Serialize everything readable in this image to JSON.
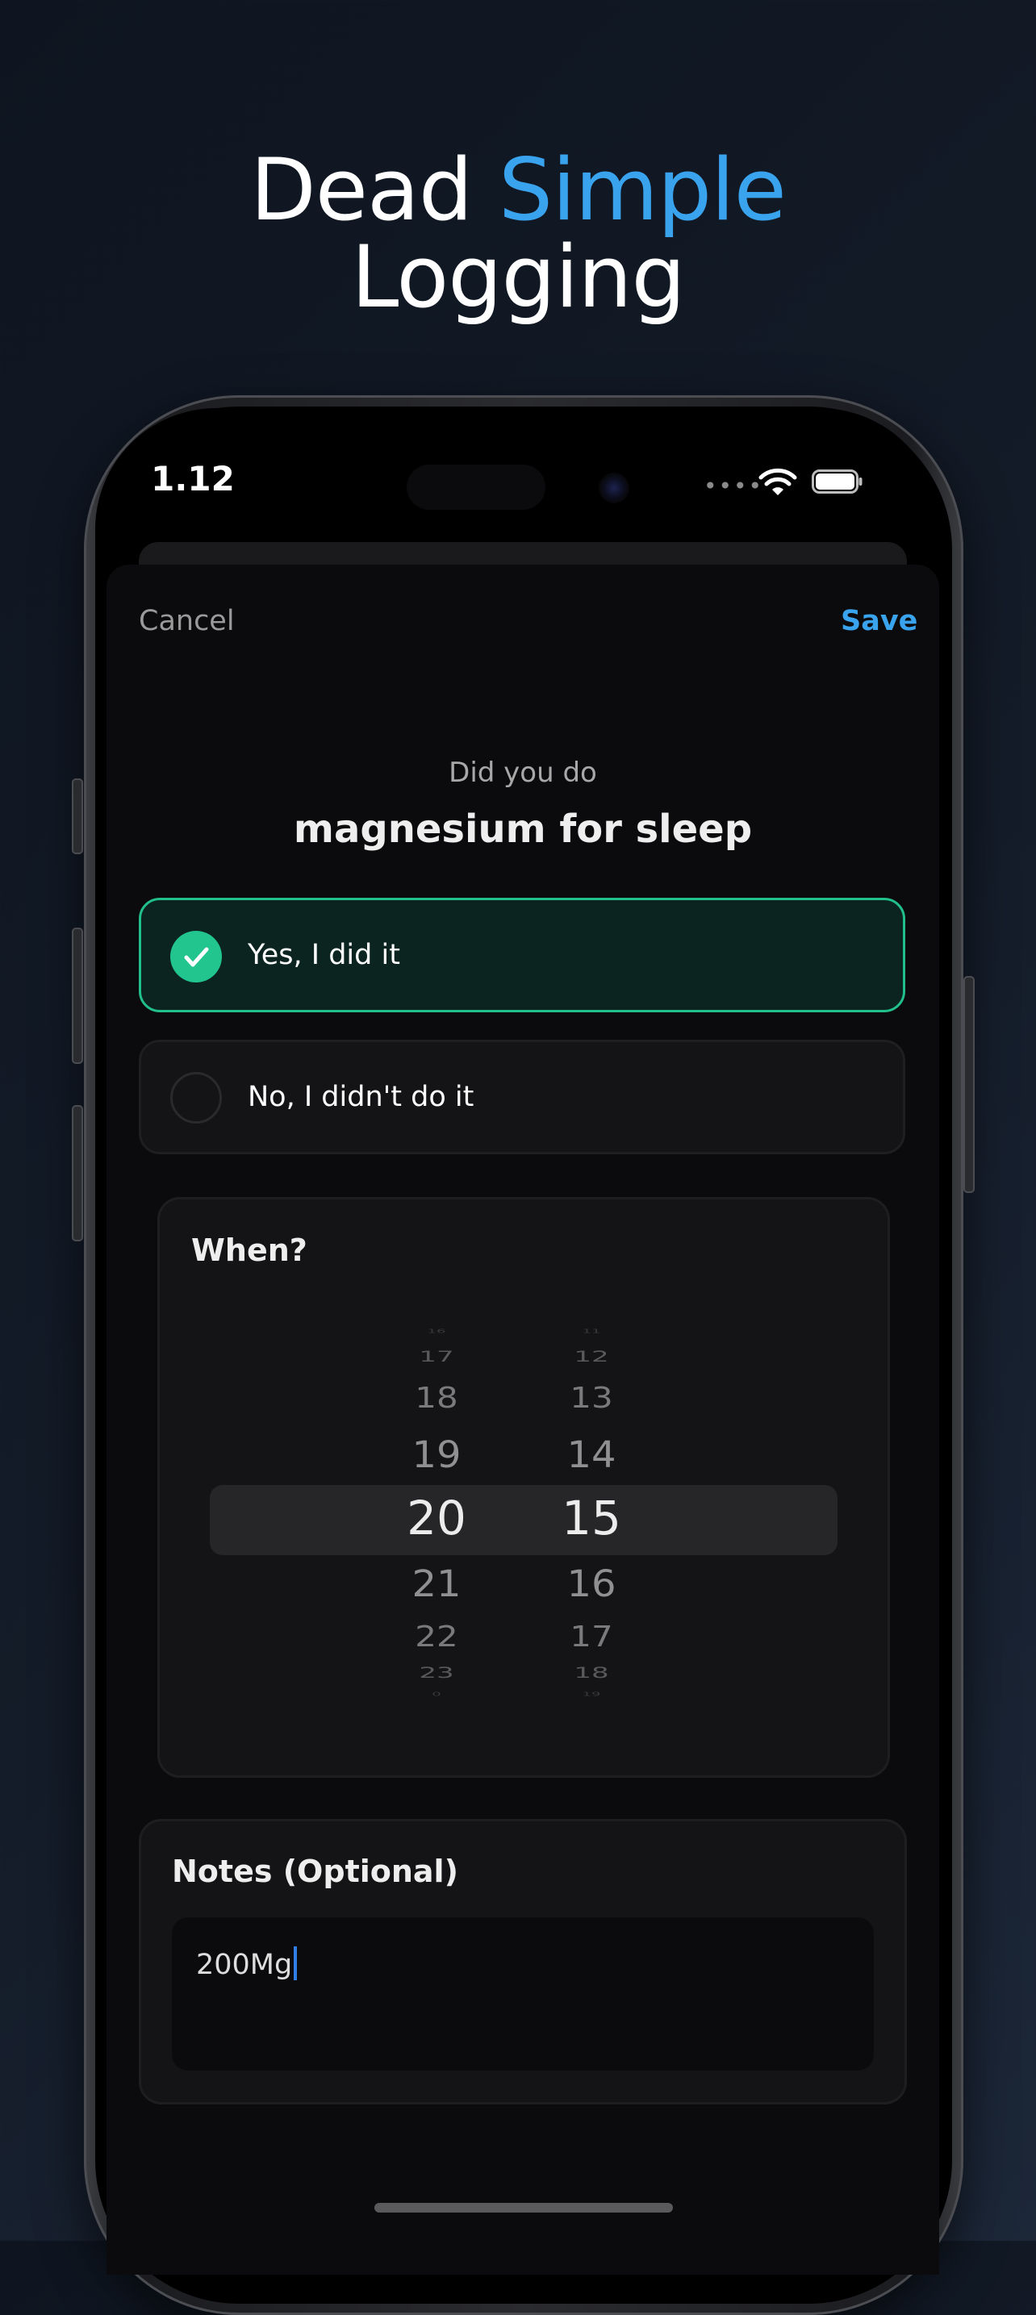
{
  "headline": {
    "word1": "Dead",
    "accent_word": "Simple",
    "line2": "Logging"
  },
  "status_bar": {
    "time": "1.12",
    "signal_dots": "••••",
    "wifi_icon": "wifi-icon",
    "battery_icon": "battery-icon"
  },
  "nav": {
    "cancel_label": "Cancel",
    "save_label": "Save"
  },
  "prompt": {
    "subtitle": "Did you do",
    "habit_name": "magnesium for sleep"
  },
  "options": {
    "yes_label": "Yes, I did it",
    "no_label": "No, I didn't do it",
    "selected": "yes"
  },
  "when": {
    "title": "When?",
    "hours": [
      "16",
      "17",
      "18",
      "19",
      "20",
      "21",
      "22",
      "23",
      "0"
    ],
    "minutes": [
      "11",
      "12",
      "13",
      "14",
      "15",
      "16",
      "17",
      "18",
      "19"
    ],
    "selected_hour": "20",
    "selected_minute": "15"
  },
  "notes": {
    "title": "Notes (Optional)",
    "value": "200Mg"
  },
  "colors": {
    "accent": "#3aa3ee",
    "success": "#22c58d",
    "background": "#0b0b0d"
  }
}
